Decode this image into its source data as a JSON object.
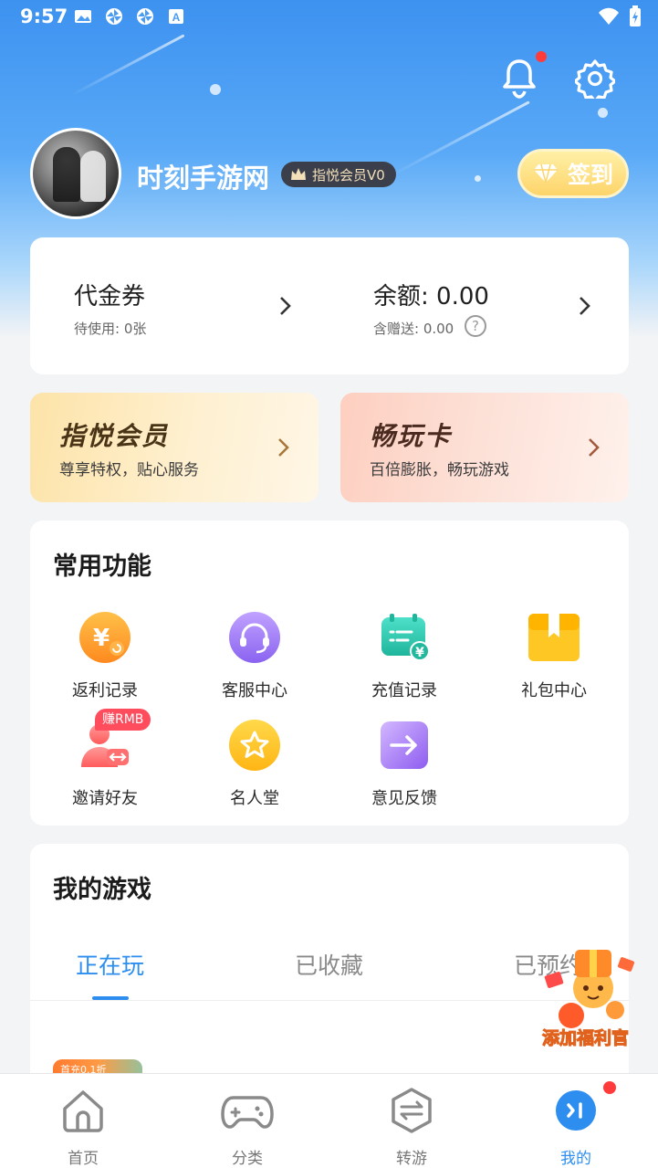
{
  "status_bar": {
    "time": "9:57",
    "left_icons": [
      "image-icon",
      "pinwheel-icon",
      "pinwheel-icon",
      "font-a-icon"
    ],
    "right_icons": [
      "wifi-icon",
      "battery-charging-icon"
    ]
  },
  "header": {
    "notification_dot": true
  },
  "profile": {
    "username": "时刻手游网",
    "vip_badge": "指悦会员V0",
    "checkin_label": "签到"
  },
  "wallet": {
    "voucher_title": "代金券",
    "voucher_sub": "待使用: 0张",
    "balance_title": "余额: 0.00",
    "balance_sub": "含赠送: 0.00",
    "help_symbol": "?"
  },
  "promos": [
    {
      "title": "指悦会员",
      "subtitle": "尊享特权，贴心服务"
    },
    {
      "title": "畅玩卡",
      "subtitle": "百倍膨胀，畅玩游戏"
    }
  ],
  "functions": {
    "title": "常用功能",
    "items": [
      {
        "label": "返利记录",
        "icon": "rebate-icon"
      },
      {
        "label": "客服中心",
        "icon": "headset-icon"
      },
      {
        "label": "充值记录",
        "icon": "recharge-icon"
      },
      {
        "label": "礼包中心",
        "icon": "gift-box-icon"
      },
      {
        "label": "邀请好友",
        "icon": "invite-icon",
        "badge": "赚RMB"
      },
      {
        "label": "名人堂",
        "icon": "star-icon"
      },
      {
        "label": "意见反馈",
        "icon": "feedback-icon"
      }
    ]
  },
  "games": {
    "title": "我的游戏",
    "tabs": [
      "正在玩",
      "已收藏",
      "已预约"
    ],
    "active_tab": 0,
    "thumb_badge": "首充0.1折"
  },
  "floating": {
    "label": "添加福利官"
  },
  "bottom_nav": {
    "items": [
      {
        "label": "首页",
        "icon": "home-icon"
      },
      {
        "label": "分类",
        "icon": "gamepad-icon"
      },
      {
        "label": "转游",
        "icon": "transfer-icon"
      },
      {
        "label": "我的",
        "icon": "profile-icon"
      }
    ],
    "active": 3
  },
  "colors": {
    "accent": "#2d8ef0",
    "notification": "#ff3b3b"
  }
}
